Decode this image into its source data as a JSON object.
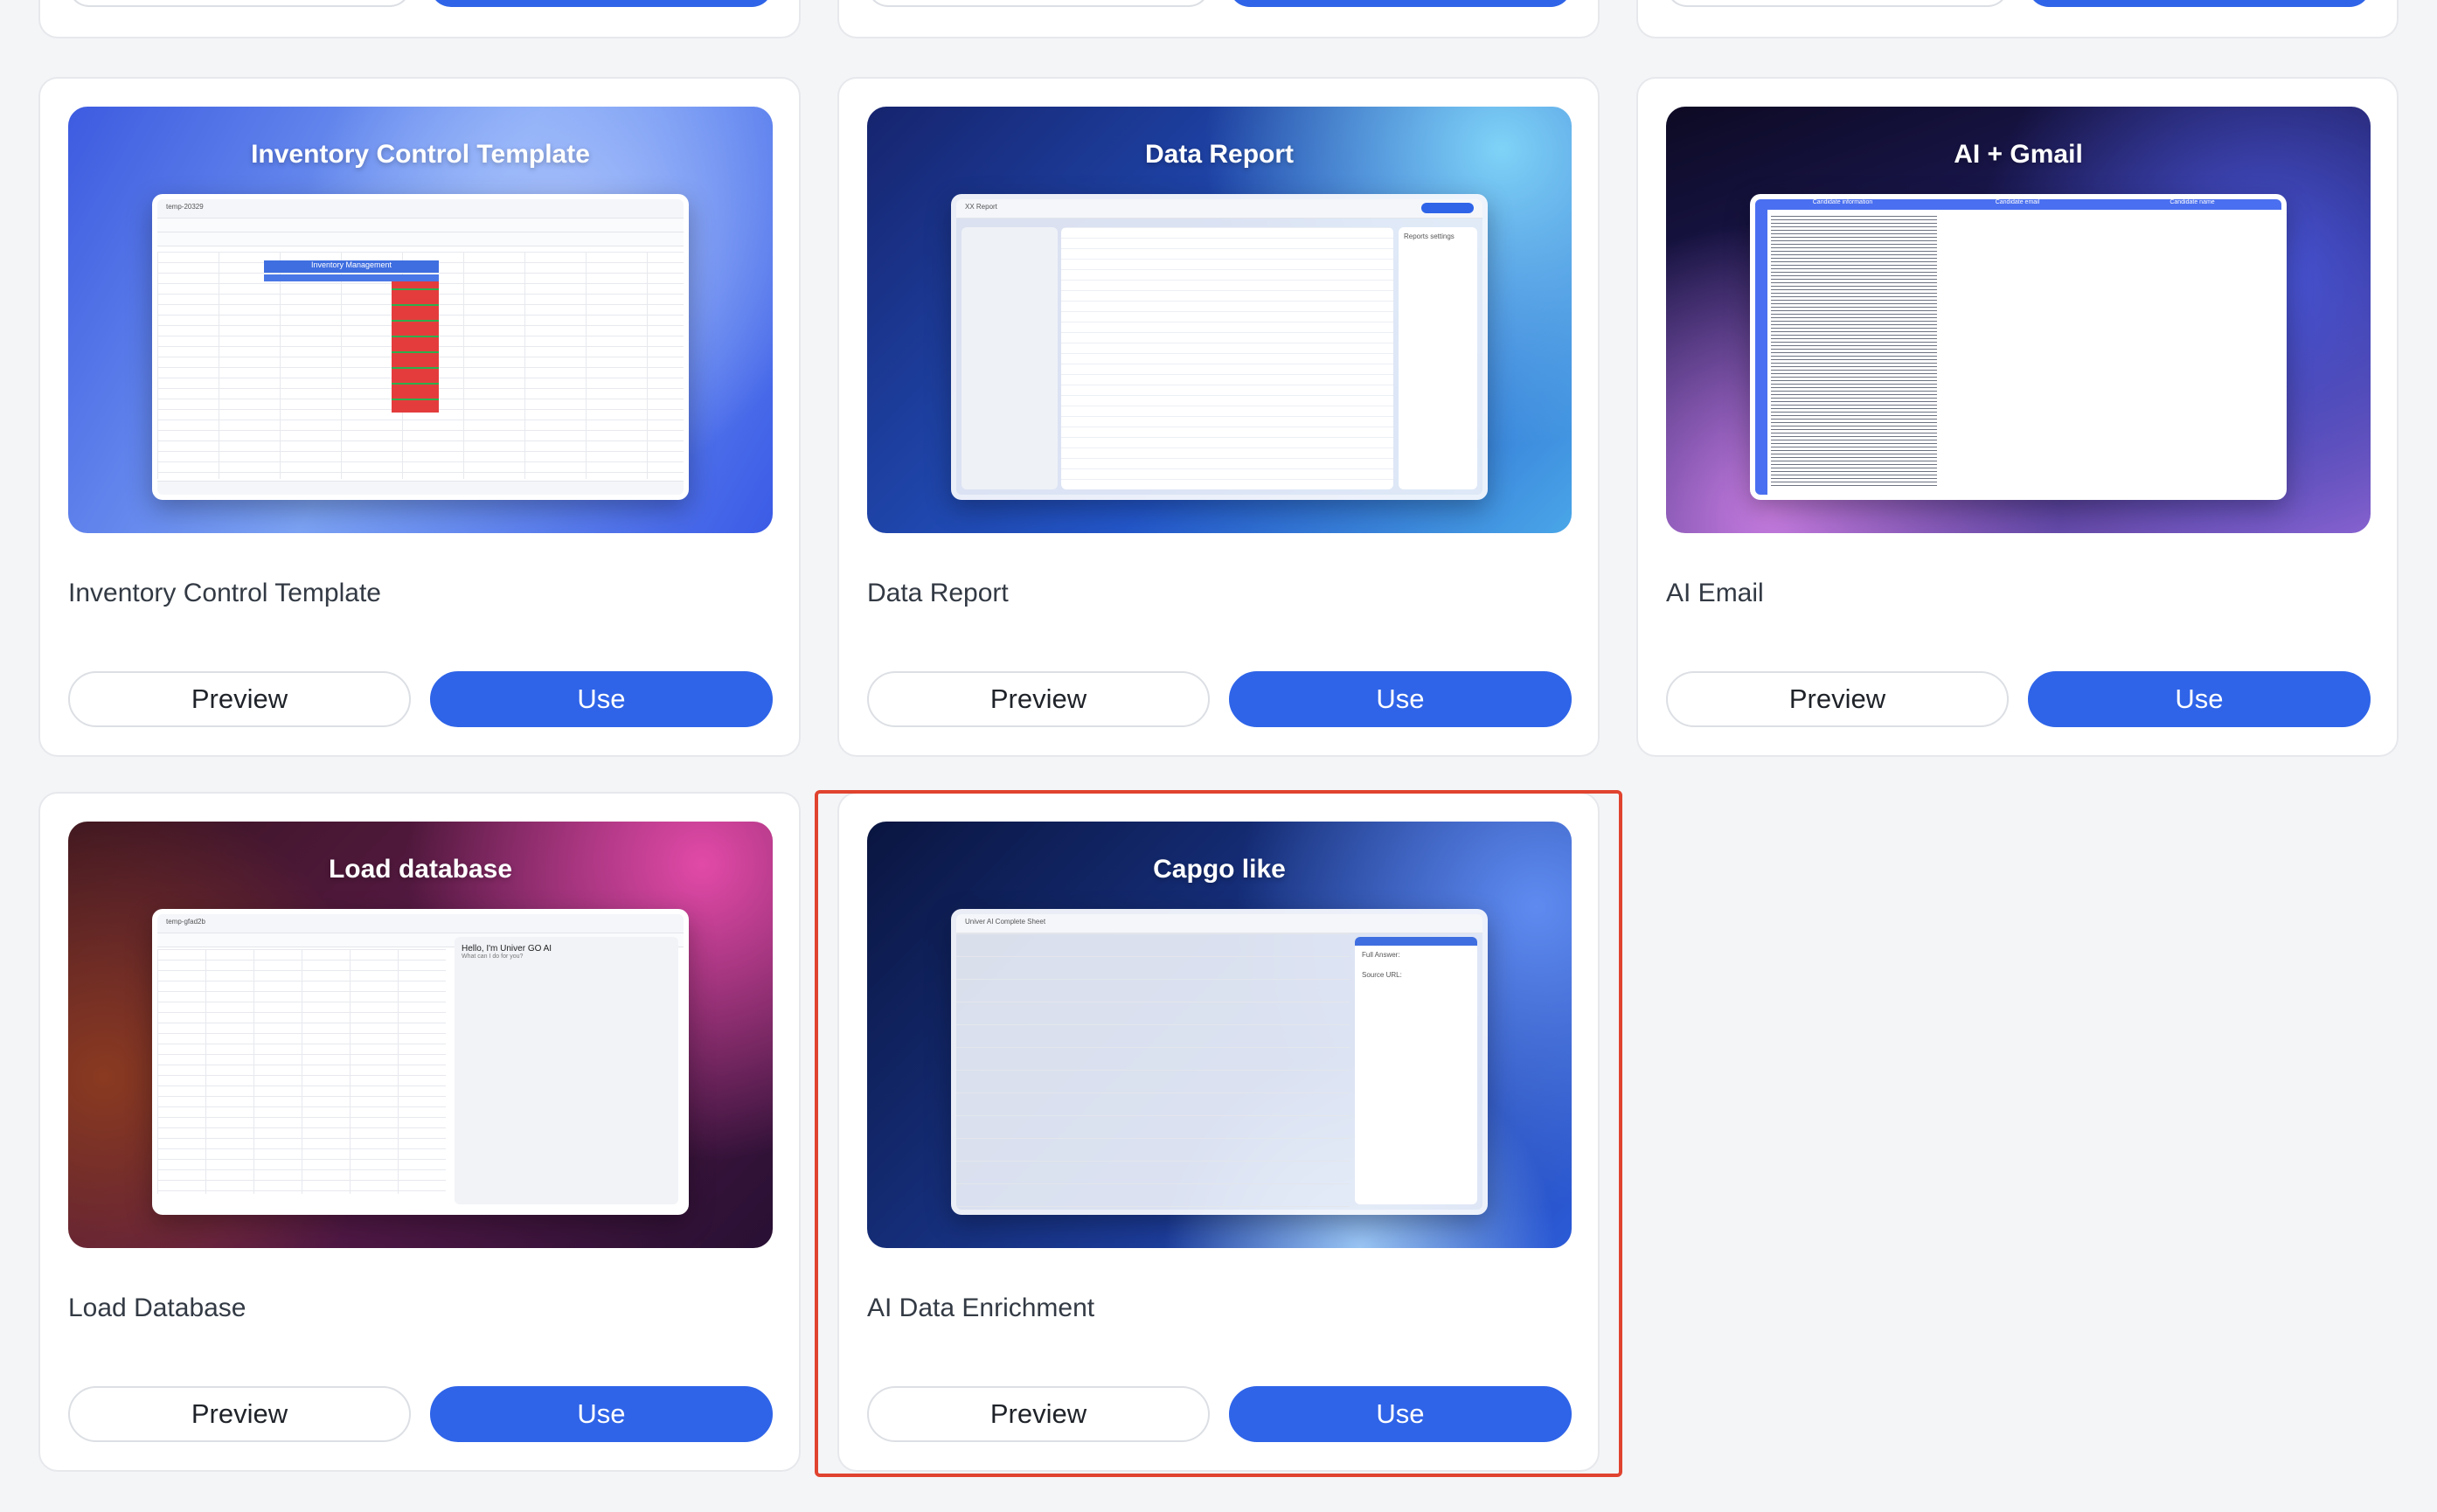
{
  "top_row": {
    "preview_label": "",
    "use_label": ""
  },
  "cards": [
    {
      "thumb_title": "Inventory Control Template",
      "title": "Inventory Control Template",
      "preview_label": "Preview",
      "use_label": "Use",
      "gradient": [
        "#3d5be0",
        "#7ca3f5",
        "#3b5be6"
      ]
    },
    {
      "thumb_title": "Data Report",
      "title": "Data Report",
      "preview_label": "Preview",
      "use_label": "Use",
      "gradient": [
        "#1d2f8c",
        "#2356c9",
        "#6ac0f0"
      ]
    },
    {
      "thumb_title": "AI + Gmail",
      "title": "AI Email",
      "preview_label": "Preview",
      "use_label": "Use",
      "gradient": [
        "#120d2e",
        "#2a2e8f",
        "#b36fd8"
      ]
    },
    {
      "thumb_title": "Load database",
      "title": "Load Database",
      "preview_label": "Preview",
      "use_label": "Use",
      "gradient": [
        "#3a1520",
        "#7a1f5a",
        "#d34b9c"
      ]
    },
    {
      "thumb_title": "Capgo like",
      "title": "AI Data Enrichment",
      "preview_label": "Preview",
      "use_label": "Use",
      "gradient": [
        "#0d1a4a",
        "#1e3f9c",
        "#5f8bf0"
      ]
    }
  ],
  "mock_text": {
    "inventory_header": "Inventory Management",
    "inventory_file": "temp-20329",
    "report_title": "XX Report",
    "report_panel": "Reports settings",
    "gmail_col1": "Candidate information",
    "gmail_col2": "Candidate email",
    "gmail_col3": "Candidate name",
    "loaddb_file": "temp-gfad2b",
    "loaddb_greeting": "Hello, I'm Univer GO AI",
    "loaddb_sub": "What can I do for you?",
    "enrich_title": "Univer AI Complete Sheet",
    "enrich_answer": "Full Answer:",
    "enrich_source": "Source URL:"
  },
  "colors": {
    "accent": "#2f64e8",
    "highlight": "#e0432f"
  }
}
